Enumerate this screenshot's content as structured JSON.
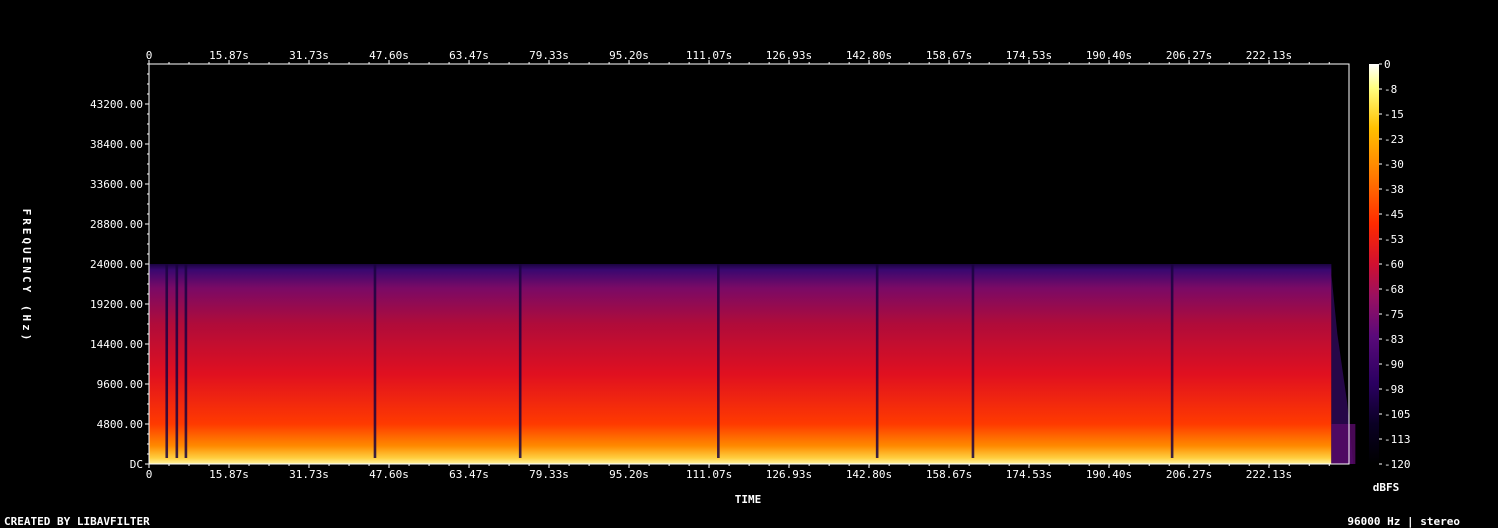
{
  "chart_data": {
    "type": "heatmap",
    "title": "",
    "xlabel": "TIME",
    "ylabel": "FREQUENCY (Hz)",
    "x_tick_labels": [
      "0",
      "15.87s",
      "31.73s",
      "47.60s",
      "63.47s",
      "79.33s",
      "95.20s",
      "111.07s",
      "126.93s",
      "142.80s",
      "158.67s",
      "174.53s",
      "190.40s",
      "206.27s",
      "222.13s"
    ],
    "x_ticks_s": [
      0,
      15.87,
      31.73,
      47.6,
      63.47,
      79.33,
      95.2,
      111.07,
      126.93,
      142.8,
      158.67,
      174.53,
      190.4,
      206.27,
      222.13
    ],
    "xlim_s": [
      0,
      238
    ],
    "y_tick_labels": [
      "DC",
      "4800.00",
      "9600.00",
      "14400.00",
      "19200.00",
      "24000.00",
      "28800.00",
      "33600.00",
      "38400.00",
      "43200.00"
    ],
    "y_ticks_hz": [
      0,
      4800,
      9600,
      14400,
      19200,
      24000,
      28800,
      33600,
      38400,
      43200
    ],
    "ylim_hz": [
      0,
      48000
    ],
    "signal_cutoff_hz": 24000,
    "audio_end_s": 234.5,
    "quiet_gaps_s": [
      3.5,
      5.5,
      7.3,
      44.8,
      73.6,
      112.9,
      144.4,
      163.4,
      202.9
    ],
    "colorbar": {
      "label": "dBFS",
      "tick_labels": [
        "0",
        "-8",
        "-15",
        "-23",
        "-30",
        "-38",
        "-45",
        "-53",
        "-60",
        "-68",
        "-75",
        "-83",
        "-90",
        "-98",
        "-105",
        "-113",
        "-120"
      ],
      "range_db": [
        -120,
        0
      ],
      "colors": [
        "#000000",
        "#0a0024",
        "#2a0060",
        "#5a0a7a",
        "#9a1060",
        "#d01030",
        "#ff2a00",
        "#ff7a00",
        "#ffc000",
        "#ffff80",
        "#ffffff"
      ]
    }
  },
  "footer": {
    "left": "CREATED BY LIBAVFILTER",
    "right": "96000 Hz | stereo"
  }
}
